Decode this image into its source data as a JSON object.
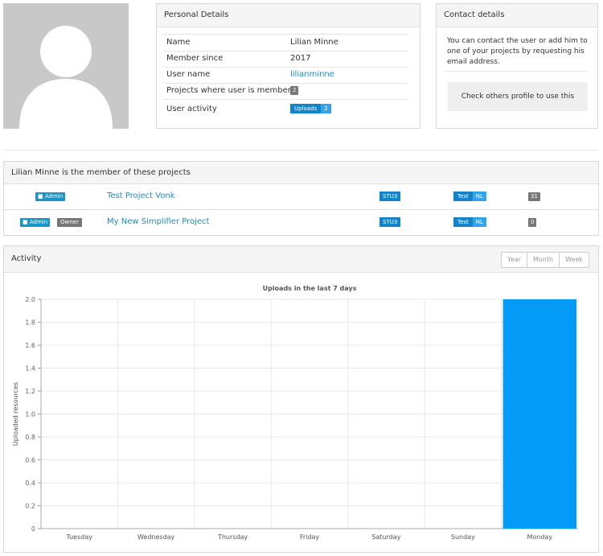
{
  "profile": {
    "personal_title": "Personal Details",
    "rows": [
      {
        "key": "Name",
        "value": "Lilian Minne"
      },
      {
        "key": "Member since",
        "value": "2017"
      },
      {
        "key": "User name",
        "value": "lilianminne"
      },
      {
        "key": "Projects where user is member",
        "value": "2"
      },
      {
        "key": "User activity",
        "value": "Uploads",
        "count": "2"
      }
    ]
  },
  "contact": {
    "title": "Contact details",
    "text": "You can contact the user or add him to one of your projects by requesting his email address.",
    "button": "Check others profile to use this"
  },
  "projects": {
    "title": "Lilian Minne is the member of these projects",
    "items": [
      {
        "roles": [
          "Admin"
        ],
        "name": "Test Project Vonk",
        "version": "STU3",
        "env": "Test",
        "lang": "NL",
        "count": "31"
      },
      {
        "roles": [
          "Admin",
          "Owner"
        ],
        "name": "My New Simplifier Project",
        "version": "STU3",
        "env": "Test",
        "lang": "NL",
        "count": "0"
      }
    ]
  },
  "activity": {
    "title": "Activity",
    "ranges": [
      "Year",
      "Month",
      "Week"
    ]
  },
  "colors": {
    "accent": "#1a95c7",
    "bar": "#039bf5"
  },
  "chart_data": {
    "type": "bar",
    "title": "Uploads in the last 7 days",
    "ylabel": "Uploaded resources",
    "xlabel": "",
    "categories": [
      "Tuesday",
      "Wednesday",
      "Thursday",
      "Friday",
      "Saturday",
      "Sunday",
      "Monday"
    ],
    "values": [
      0,
      0,
      0,
      0,
      0,
      0,
      2
    ],
    "ylim": [
      0,
      2
    ],
    "yticks": [
      "0",
      "0.2",
      "0.4",
      "0.6",
      "0.8",
      "1.0",
      "1.2",
      "1.4",
      "1.6",
      "1.8",
      "2.0"
    ],
    "grid": true
  }
}
